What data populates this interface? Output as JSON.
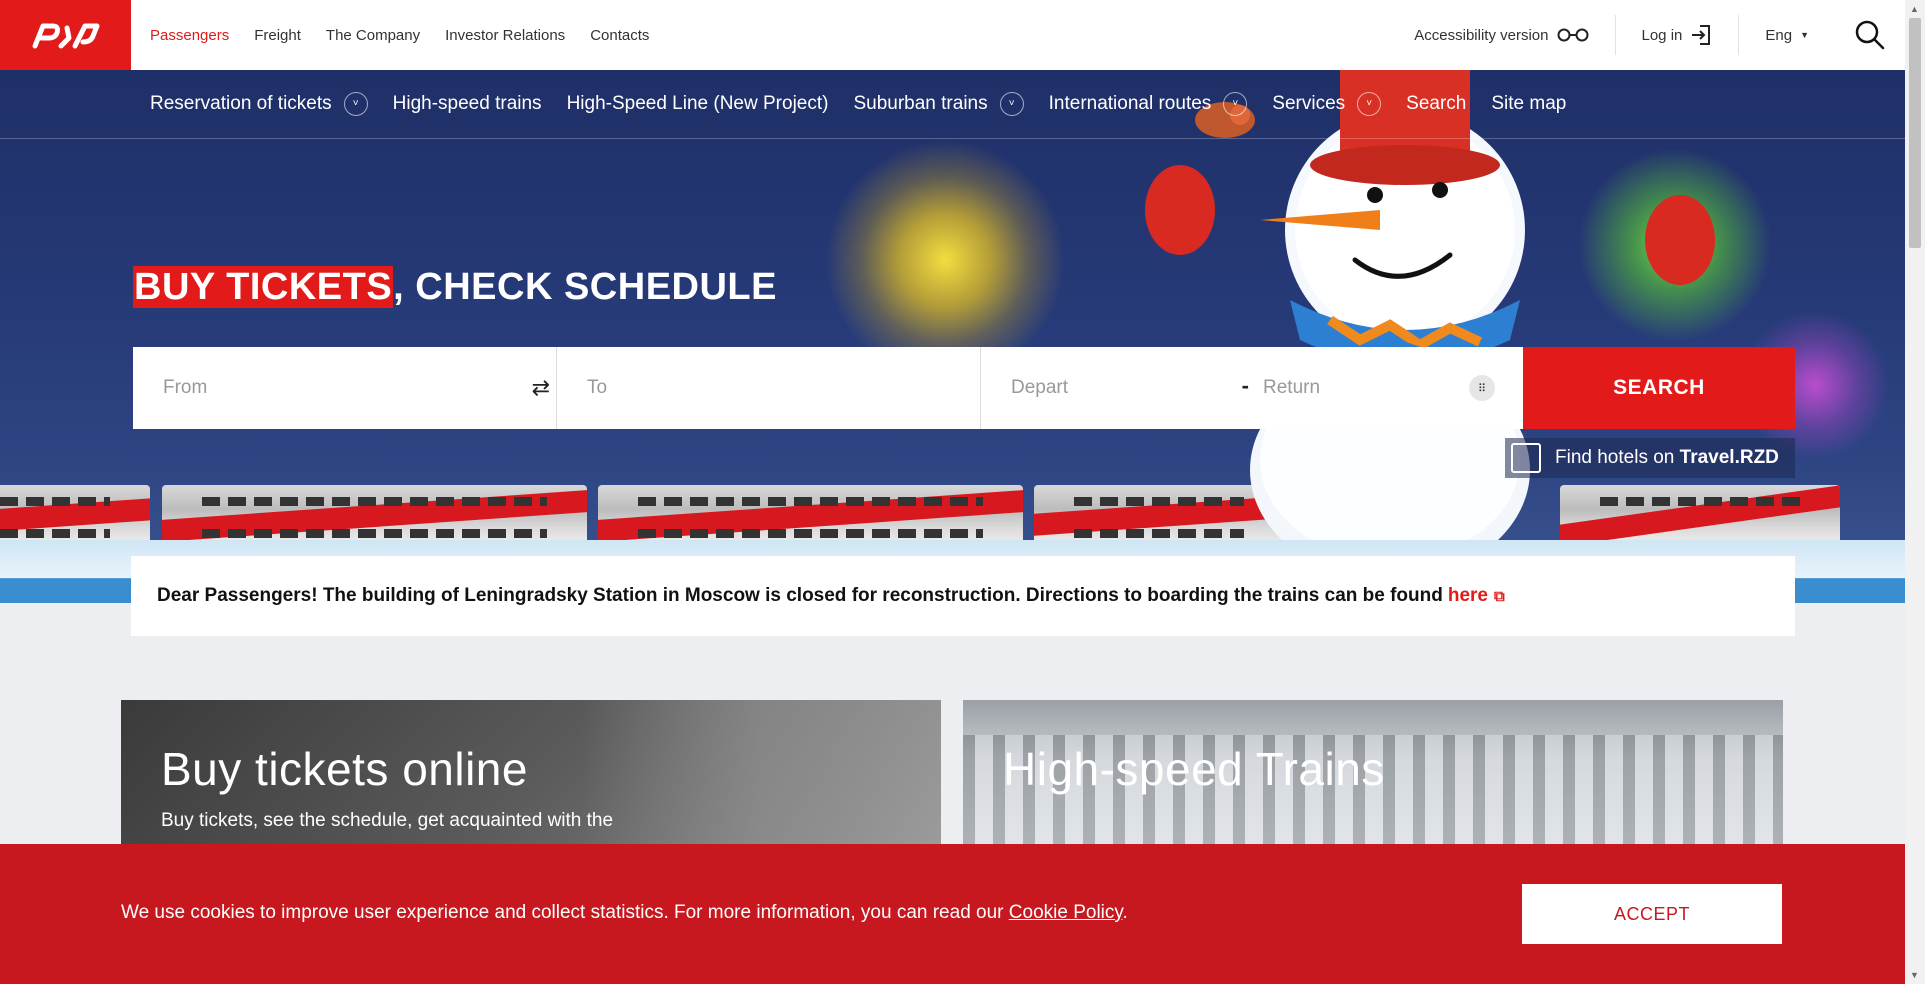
{
  "header": {
    "logo_text": "РЖД",
    "nav": [
      "Passengers",
      "Freight",
      "The Company",
      "Investor Relations",
      "Contacts"
    ],
    "accessibility_label": "Accessibility version",
    "login_label": "Log in",
    "language": "Eng"
  },
  "main_nav": {
    "reservation": "Reservation of tickets",
    "highspeed": "High-speed trains",
    "hsl": "High-Speed Line (New Project)",
    "suburban": "Suburban trains",
    "international": "International routes",
    "services": "Services",
    "search": "Search",
    "sitemap": "Site map"
  },
  "hero": {
    "headline_highlight": "BUY TICKETS",
    "headline_rest": ", CHECK SCHEDULE"
  },
  "search_form": {
    "from_placeholder": "From",
    "to_placeholder": "To",
    "depart_placeholder": "Depart",
    "return_placeholder": "Return",
    "dash": "-",
    "button_label": "SEARCH",
    "hotels_text": "Find hotels on",
    "hotels_brand": "Travel.RZD"
  },
  "notice": {
    "text": "Dear Passengers! The building of Leningradsky Station in Moscow is closed for reconstruction. Directions to boarding the trains can be found",
    "link_label": "here"
  },
  "cards": {
    "card1_title": "Buy tickets online",
    "card1_sub": "Buy tickets, see the schedule, get acquainted with the",
    "card2_title": "High-speed Trains"
  },
  "cookie": {
    "text": "We use cookies to improve user experience and collect statistics. For more information, you can read our",
    "link": "Cookie Policy",
    "period": ".",
    "accept_label": "ACCEPT"
  },
  "colors": {
    "brand_red": "#e21a1a",
    "hero_blue": "#263a78",
    "cookie_red": "#c7181f"
  }
}
